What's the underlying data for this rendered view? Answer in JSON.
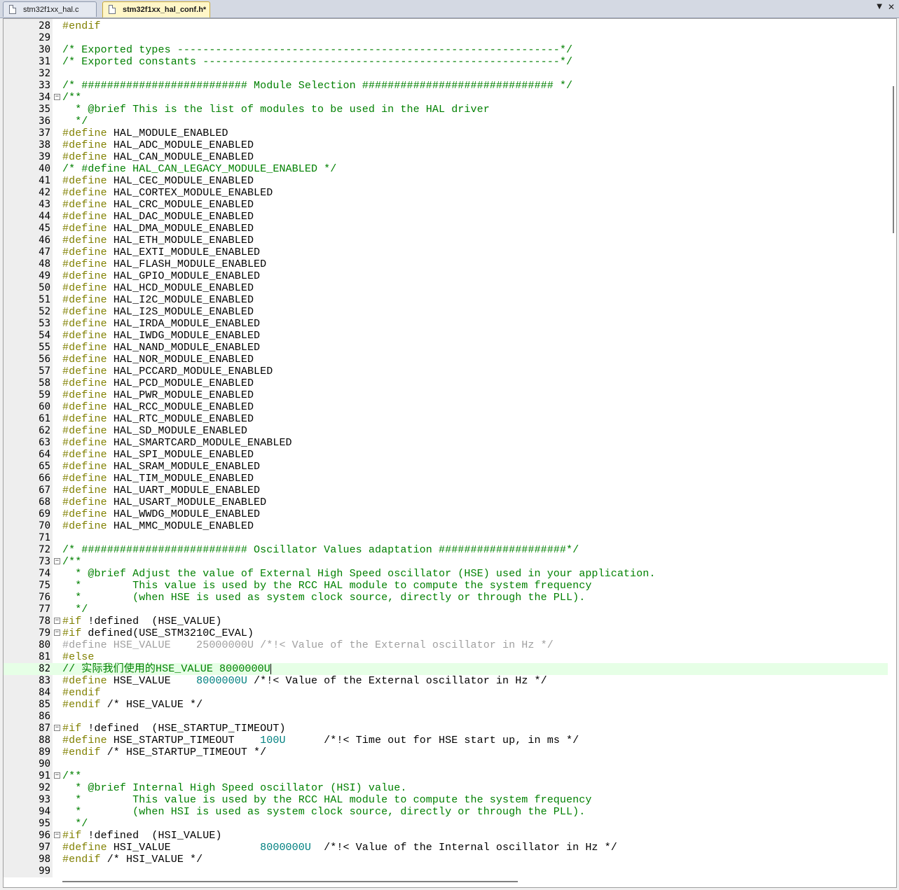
{
  "tabs": [
    {
      "label": "stm32f1xx_hal.c",
      "active": false
    },
    {
      "label": "stm32f1xx_hal_conf.h*",
      "active": true
    }
  ],
  "icons": {
    "file": "file-icon",
    "tab_menu": "chevron-down-icon",
    "close": "close-icon"
  },
  "colors": {
    "preprocessor": "#808000",
    "comment": "#008000",
    "number": "#008080",
    "inactive": "#a0a0a0",
    "current_line": "#e6ffe6"
  },
  "editor": {
    "current_line": 82,
    "lines": [
      {
        "n": "28",
        "fold": "",
        "segs": [
          [
            "pp",
            "#endif"
          ]
        ]
      },
      {
        "n": "29",
        "fold": "",
        "segs": []
      },
      {
        "n": "30",
        "fold": "",
        "segs": [
          [
            "cm",
            "/* Exported types ------------------------------------------------------------*/"
          ]
        ]
      },
      {
        "n": "31",
        "fold": "",
        "segs": [
          [
            "cm",
            "/* Exported constants --------------------------------------------------------*/"
          ]
        ]
      },
      {
        "n": "32",
        "fold": "",
        "segs": []
      },
      {
        "n": "33",
        "fold": "",
        "segs": [
          [
            "cm",
            "/* ########################## Module Selection ############################## */"
          ]
        ]
      },
      {
        "n": "34",
        "fold": "-",
        "segs": [
          [
            "cm",
            "/**"
          ]
        ]
      },
      {
        "n": "35",
        "fold": "",
        "segs": [
          [
            "cm",
            "  * @brief This is the list of modules to be used in the HAL driver"
          ]
        ]
      },
      {
        "n": "36",
        "fold": "",
        "segs": [
          [
            "cm",
            "  */"
          ]
        ]
      },
      {
        "n": "37",
        "fold": "",
        "segs": [
          [
            "pp",
            "#define"
          ],
          [
            "id",
            " HAL_MODULE_ENABLED"
          ]
        ]
      },
      {
        "n": "38",
        "fold": "",
        "segs": [
          [
            "pp",
            "#define"
          ],
          [
            "id",
            " HAL_ADC_MODULE_ENABLED"
          ]
        ]
      },
      {
        "n": "39",
        "fold": "",
        "segs": [
          [
            "pp",
            "#define"
          ],
          [
            "id",
            " HAL_CAN_MODULE_ENABLED"
          ]
        ]
      },
      {
        "n": "40",
        "fold": "",
        "segs": [
          [
            "cm",
            "/* #define HAL_CAN_LEGACY_MODULE_ENABLED */"
          ]
        ]
      },
      {
        "n": "41",
        "fold": "",
        "segs": [
          [
            "pp",
            "#define"
          ],
          [
            "id",
            " HAL_CEC_MODULE_ENABLED"
          ]
        ]
      },
      {
        "n": "42",
        "fold": "",
        "segs": [
          [
            "pp",
            "#define"
          ],
          [
            "id",
            " HAL_CORTEX_MODULE_ENABLED"
          ]
        ]
      },
      {
        "n": "43",
        "fold": "",
        "segs": [
          [
            "pp",
            "#define"
          ],
          [
            "id",
            " HAL_CRC_MODULE_ENABLED"
          ]
        ]
      },
      {
        "n": "44",
        "fold": "",
        "segs": [
          [
            "pp",
            "#define"
          ],
          [
            "id",
            " HAL_DAC_MODULE_ENABLED"
          ]
        ]
      },
      {
        "n": "45",
        "fold": "",
        "segs": [
          [
            "pp",
            "#define"
          ],
          [
            "id",
            " HAL_DMA_MODULE_ENABLED"
          ]
        ]
      },
      {
        "n": "46",
        "fold": "",
        "segs": [
          [
            "pp",
            "#define"
          ],
          [
            "id",
            " HAL_ETH_MODULE_ENABLED"
          ]
        ]
      },
      {
        "n": "47",
        "fold": "",
        "segs": [
          [
            "pp",
            "#define"
          ],
          [
            "id",
            " HAL_EXTI_MODULE_ENABLED"
          ]
        ]
      },
      {
        "n": "48",
        "fold": "",
        "segs": [
          [
            "pp",
            "#define"
          ],
          [
            "id",
            " HAL_FLASH_MODULE_ENABLED"
          ]
        ]
      },
      {
        "n": "49",
        "fold": "",
        "segs": [
          [
            "pp",
            "#define"
          ],
          [
            "id",
            " HAL_GPIO_MODULE_ENABLED"
          ]
        ]
      },
      {
        "n": "50",
        "fold": "",
        "segs": [
          [
            "pp",
            "#define"
          ],
          [
            "id",
            " HAL_HCD_MODULE_ENABLED"
          ]
        ]
      },
      {
        "n": "51",
        "fold": "",
        "segs": [
          [
            "pp",
            "#define"
          ],
          [
            "id",
            " HAL_I2C_MODULE_ENABLED"
          ]
        ]
      },
      {
        "n": "52",
        "fold": "",
        "segs": [
          [
            "pp",
            "#define"
          ],
          [
            "id",
            " HAL_I2S_MODULE_ENABLED"
          ]
        ]
      },
      {
        "n": "53",
        "fold": "",
        "segs": [
          [
            "pp",
            "#define"
          ],
          [
            "id",
            " HAL_IRDA_MODULE_ENABLED"
          ]
        ]
      },
      {
        "n": "54",
        "fold": "",
        "segs": [
          [
            "pp",
            "#define"
          ],
          [
            "id",
            " HAL_IWDG_MODULE_ENABLED"
          ]
        ]
      },
      {
        "n": "55",
        "fold": "",
        "segs": [
          [
            "pp",
            "#define"
          ],
          [
            "id",
            " HAL_NAND_MODULE_ENABLED"
          ]
        ]
      },
      {
        "n": "56",
        "fold": "",
        "segs": [
          [
            "pp",
            "#define"
          ],
          [
            "id",
            " HAL_NOR_MODULE_ENABLED"
          ]
        ]
      },
      {
        "n": "57",
        "fold": "",
        "segs": [
          [
            "pp",
            "#define"
          ],
          [
            "id",
            " HAL_PCCARD_MODULE_ENABLED"
          ]
        ]
      },
      {
        "n": "58",
        "fold": "",
        "segs": [
          [
            "pp",
            "#define"
          ],
          [
            "id",
            " HAL_PCD_MODULE_ENABLED"
          ]
        ]
      },
      {
        "n": "59",
        "fold": "",
        "segs": [
          [
            "pp",
            "#define"
          ],
          [
            "id",
            " HAL_PWR_MODULE_ENABLED"
          ]
        ]
      },
      {
        "n": "60",
        "fold": "",
        "segs": [
          [
            "pp",
            "#define"
          ],
          [
            "id",
            " HAL_RCC_MODULE_ENABLED"
          ]
        ]
      },
      {
        "n": "61",
        "fold": "",
        "segs": [
          [
            "pp",
            "#define"
          ],
          [
            "id",
            " HAL_RTC_MODULE_ENABLED"
          ]
        ]
      },
      {
        "n": "62",
        "fold": "",
        "segs": [
          [
            "pp",
            "#define"
          ],
          [
            "id",
            " HAL_SD_MODULE_ENABLED"
          ]
        ]
      },
      {
        "n": "63",
        "fold": "",
        "segs": [
          [
            "pp",
            "#define"
          ],
          [
            "id",
            " HAL_SMARTCARD_MODULE_ENABLED"
          ]
        ]
      },
      {
        "n": "64",
        "fold": "",
        "segs": [
          [
            "pp",
            "#define"
          ],
          [
            "id",
            " HAL_SPI_MODULE_ENABLED"
          ]
        ]
      },
      {
        "n": "65",
        "fold": "",
        "segs": [
          [
            "pp",
            "#define"
          ],
          [
            "id",
            " HAL_SRAM_MODULE_ENABLED"
          ]
        ]
      },
      {
        "n": "66",
        "fold": "",
        "segs": [
          [
            "pp",
            "#define"
          ],
          [
            "id",
            " HAL_TIM_MODULE_ENABLED"
          ]
        ]
      },
      {
        "n": "67",
        "fold": "",
        "segs": [
          [
            "pp",
            "#define"
          ],
          [
            "id",
            " HAL_UART_MODULE_ENABLED"
          ]
        ]
      },
      {
        "n": "68",
        "fold": "",
        "segs": [
          [
            "pp",
            "#define"
          ],
          [
            "id",
            " HAL_USART_MODULE_ENABLED"
          ]
        ]
      },
      {
        "n": "69",
        "fold": "",
        "segs": [
          [
            "pp",
            "#define"
          ],
          [
            "id",
            " HAL_WWDG_MODULE_ENABLED"
          ]
        ]
      },
      {
        "n": "70",
        "fold": "",
        "segs": [
          [
            "pp",
            "#define"
          ],
          [
            "id",
            " HAL_MMC_MODULE_ENABLED"
          ]
        ]
      },
      {
        "n": "71",
        "fold": "",
        "segs": []
      },
      {
        "n": "72",
        "fold": "",
        "segs": [
          [
            "cm",
            "/* ########################## Oscillator Values adaptation ####################*/"
          ]
        ]
      },
      {
        "n": "73",
        "fold": "-",
        "segs": [
          [
            "cm",
            "/**"
          ]
        ]
      },
      {
        "n": "74",
        "fold": "",
        "segs": [
          [
            "cm",
            "  * @brief Adjust the value of External High Speed oscillator (HSE) used in your application."
          ]
        ]
      },
      {
        "n": "75",
        "fold": "",
        "segs": [
          [
            "cm",
            "  *        This value is used by the RCC HAL module to compute the system frequency"
          ]
        ]
      },
      {
        "n": "76",
        "fold": "",
        "segs": [
          [
            "cm",
            "  *        (when HSE is used as system clock source, directly or through the PLL)."
          ]
        ]
      },
      {
        "n": "77",
        "fold": "",
        "segs": [
          [
            "cm",
            "  */"
          ]
        ]
      },
      {
        "n": "78",
        "fold": "-",
        "segs": [
          [
            "pp",
            "#if"
          ],
          [
            "id",
            " !defined  (HSE_VALUE)"
          ]
        ]
      },
      {
        "n": "79",
        "fold": "-",
        "segs": [
          [
            "pp",
            "#if"
          ],
          [
            "id",
            " defined(USE_STM3210C_EVAL)"
          ]
        ]
      },
      {
        "n": "80",
        "fold": "",
        "segs": [
          [
            "in",
            "#define HSE_VALUE    25000000U /*!< Value of the External oscillator in Hz */"
          ]
        ]
      },
      {
        "n": "81",
        "fold": "",
        "segs": [
          [
            "pp",
            "#else"
          ]
        ]
      },
      {
        "n": "82",
        "fold": "",
        "segs": [
          [
            "cm",
            "// 实际我们使用的HSE_VALUE 8000000U"
          ]
        ]
      },
      {
        "n": "83",
        "fold": "",
        "segs": [
          [
            "pp",
            "#define"
          ],
          [
            "id",
            " HSE_VALUE    "
          ],
          [
            "nm",
            "8000000U"
          ],
          [
            "id",
            " /*!< Value of the External oscillator in Hz */"
          ]
        ]
      },
      {
        "n": "84",
        "fold": "",
        "segs": [
          [
            "pp",
            "#endif"
          ]
        ]
      },
      {
        "n": "85",
        "fold": "",
        "segs": [
          [
            "pp",
            "#endif"
          ],
          [
            "id",
            " /* HSE_VALUE */"
          ]
        ]
      },
      {
        "n": "86",
        "fold": "",
        "segs": []
      },
      {
        "n": "87",
        "fold": "-",
        "segs": [
          [
            "pp",
            "#if"
          ],
          [
            "id",
            " !defined  (HSE_STARTUP_TIMEOUT)"
          ]
        ]
      },
      {
        "n": "88",
        "fold": "",
        "segs": [
          [
            "pp",
            "#define"
          ],
          [
            "id",
            " HSE_STARTUP_TIMEOUT    "
          ],
          [
            "nm",
            "100U"
          ],
          [
            "id",
            "      /*!< Time out for HSE start up, in ms */"
          ]
        ]
      },
      {
        "n": "89",
        "fold": "",
        "segs": [
          [
            "pp",
            "#endif"
          ],
          [
            "id",
            " /* HSE_STARTUP_TIMEOUT */"
          ]
        ]
      },
      {
        "n": "90",
        "fold": "",
        "segs": []
      },
      {
        "n": "91",
        "fold": "-",
        "segs": [
          [
            "cm",
            "/**"
          ]
        ]
      },
      {
        "n": "92",
        "fold": "",
        "segs": [
          [
            "cm",
            "  * @brief Internal High Speed oscillator (HSI) value."
          ]
        ]
      },
      {
        "n": "93",
        "fold": "",
        "segs": [
          [
            "cm",
            "  *        This value is used by the RCC HAL module to compute the system frequency"
          ]
        ]
      },
      {
        "n": "94",
        "fold": "",
        "segs": [
          [
            "cm",
            "  *        (when HSI is used as system clock source, directly or through the PLL)."
          ]
        ]
      },
      {
        "n": "95",
        "fold": "",
        "segs": [
          [
            "cm",
            "  */"
          ]
        ]
      },
      {
        "n": "96",
        "fold": "-",
        "segs": [
          [
            "pp",
            "#if"
          ],
          [
            "id",
            " !defined  (HSI_VALUE)"
          ]
        ]
      },
      {
        "n": "97",
        "fold": "",
        "segs": [
          [
            "pp",
            "#define"
          ],
          [
            "id",
            " HSI_VALUE              "
          ],
          [
            "nm",
            "8000000U"
          ],
          [
            "id",
            "  /*!< Value of the Internal oscillator in Hz */"
          ]
        ]
      },
      {
        "n": "98",
        "fold": "",
        "segs": [
          [
            "pp",
            "#endif"
          ],
          [
            "id",
            " /* HSI_VALUE */"
          ]
        ]
      },
      {
        "n": "99",
        "fold": "",
        "segs": []
      }
    ]
  }
}
